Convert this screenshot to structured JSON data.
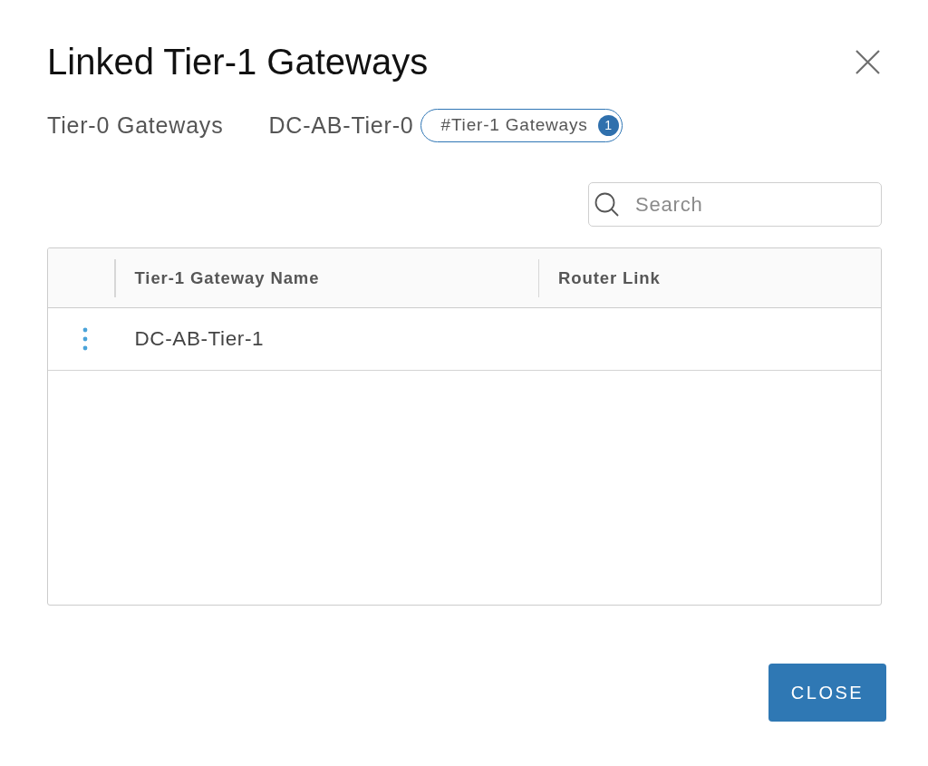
{
  "dialog": {
    "title": "Linked Tier-1 Gateways"
  },
  "breadcrumb": {
    "label": "Tier-0 Gateways",
    "gateway": "DC-AB-Tier-0",
    "badge": {
      "label": "#Tier-1 Gateways",
      "count": "1"
    }
  },
  "search": {
    "placeholder": "Search"
  },
  "table": {
    "columns": [
      "Tier-1 Gateway Name",
      "Router Link"
    ],
    "rows": [
      {
        "name": "DC-AB-Tier-1"
      }
    ]
  },
  "buttons": [
    "CLOSE"
  ]
}
